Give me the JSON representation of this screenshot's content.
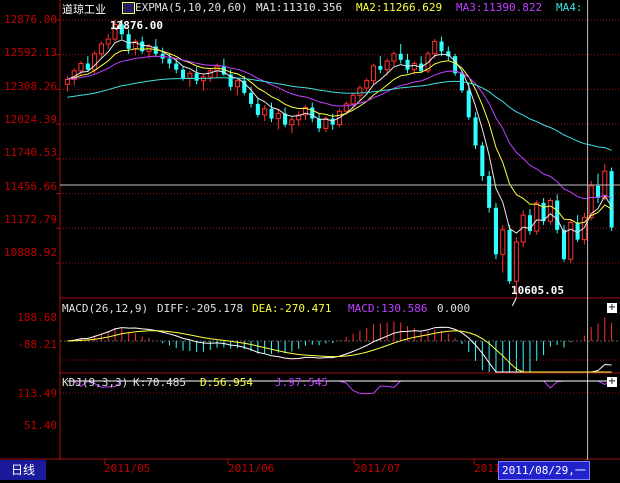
{
  "main": {
    "name": "道琼工业",
    "indicator": "EXPMA(5,10,20,60)",
    "ma": [
      {
        "label": "MA1:11310.356",
        "color": "#e8e8e8"
      },
      {
        "label": "MA2:11266.629",
        "color": "#ffff40"
      },
      {
        "label": "MA3:11390.822",
        "color": "#c040ff"
      },
      {
        "label": "MA4:",
        "color": "#40e0e0"
      }
    ],
    "y_ticks": [
      "12876.00",
      "12592.13",
      "12308.26",
      "12024.39",
      "11740.53",
      "11456.66",
      "11172.79",
      "10888.92"
    ],
    "y_values": [
      12876.0,
      12592.13,
      12308.26,
      12024.39,
      11740.53,
      11456.66,
      11172.79,
      10888.92
    ],
    "high_label": "12876.00",
    "low_label": "10605.05"
  },
  "macd": {
    "header": "MACD(26,12,9)",
    "diff": "DIFF:-205.178",
    "dea": "DEA:-270.471",
    "macd": "MACD:130.586",
    "zero": "0.000",
    "y_ticks": [
      "188.68",
      "-88.21"
    ]
  },
  "kdj": {
    "header": "KDJ(9,3,3)",
    "k": "K:70.485",
    "d": "D:56.954",
    "j": "J:97.545",
    "y_ticks": [
      "113.49",
      "51.40"
    ]
  },
  "x_axis": {
    "labels": [
      "2011/05",
      "2011/06",
      "2011/07",
      "2011/"
    ],
    "cursor_date": "2011/08/29,一",
    "period": "日线"
  },
  "colors": {
    "up": "#ff3030",
    "down": "#30ffff",
    "grid_red": "#a01010",
    "axis_text": "#c00000",
    "k_line": "#ffffff",
    "d_line": "#ffff40",
    "j_line": "#c040ff"
  },
  "chart_data": {
    "type": "candlestick",
    "series": [
      {
        "name": "OHLC",
        "values": [
          [
            12350,
            12420,
            12290,
            12390
          ],
          [
            12390,
            12480,
            12340,
            12460
          ],
          [
            12460,
            12540,
            12420,
            12520
          ],
          [
            12520,
            12580,
            12450,
            12470
          ],
          [
            12470,
            12620,
            12440,
            12600
          ],
          [
            12600,
            12700,
            12560,
            12680
          ],
          [
            12680,
            12760,
            12640,
            12720
          ],
          [
            12720,
            12880,
            12700,
            12840
          ],
          [
            12840,
            12876,
            12720,
            12760
          ],
          [
            12760,
            12800,
            12600,
            12640
          ],
          [
            12640,
            12720,
            12590,
            12700
          ],
          [
            12700,
            12740,
            12600,
            12620
          ],
          [
            12620,
            12680,
            12560,
            12660
          ],
          [
            12660,
            12720,
            12580,
            12600
          ],
          [
            12600,
            12650,
            12520,
            12560
          ],
          [
            12560,
            12600,
            12480,
            12520
          ],
          [
            12520,
            12560,
            12440,
            12470
          ],
          [
            12470,
            12500,
            12380,
            12400
          ],
          [
            12400,
            12460,
            12330,
            12440
          ],
          [
            12440,
            12490,
            12350,
            12380
          ],
          [
            12380,
            12430,
            12300,
            12410
          ],
          [
            12410,
            12480,
            12370,
            12460
          ],
          [
            12460,
            12520,
            12400,
            12500
          ],
          [
            12500,
            12560,
            12420,
            12430
          ],
          [
            12430,
            12470,
            12300,
            12330
          ],
          [
            12330,
            12400,
            12260,
            12380
          ],
          [
            12380,
            12420,
            12260,
            12280
          ],
          [
            12280,
            12330,
            12160,
            12190
          ],
          [
            12190,
            12240,
            12080,
            12100
          ],
          [
            12100,
            12180,
            12050,
            12150
          ],
          [
            12150,
            12200,
            12040,
            12070
          ],
          [
            12070,
            12140,
            11980,
            12110
          ],
          [
            12110,
            12160,
            12000,
            12020
          ],
          [
            12020,
            12090,
            11950,
            12060
          ],
          [
            12060,
            12130,
            12010,
            12100
          ],
          [
            12100,
            12180,
            12060,
            12160
          ],
          [
            12160,
            12200,
            12040,
            12070
          ],
          [
            12070,
            12110,
            11960,
            11990
          ],
          [
            11990,
            12090,
            11960,
            12070
          ],
          [
            12070,
            12110,
            11980,
            12020
          ],
          [
            12020,
            12150,
            12000,
            12130
          ],
          [
            12130,
            12210,
            12100,
            12190
          ],
          [
            12190,
            12280,
            12150,
            12260
          ],
          [
            12260,
            12340,
            12220,
            12320
          ],
          [
            12320,
            12400,
            12270,
            12380
          ],
          [
            12380,
            12520,
            12350,
            12500
          ],
          [
            12500,
            12580,
            12440,
            12470
          ],
          [
            12470,
            12560,
            12420,
            12540
          ],
          [
            12540,
            12620,
            12500,
            12600
          ],
          [
            12600,
            12680,
            12520,
            12550
          ],
          [
            12550,
            12600,
            12440,
            12470
          ],
          [
            12470,
            12540,
            12430,
            12520
          ],
          [
            12520,
            12580,
            12440,
            12460
          ],
          [
            12460,
            12620,
            12440,
            12600
          ],
          [
            12600,
            12720,
            12560,
            12700
          ],
          [
            12700,
            12740,
            12580,
            12620
          ],
          [
            12620,
            12660,
            12540,
            12580
          ],
          [
            12580,
            12600,
            12420,
            12440
          ],
          [
            12440,
            12460,
            12280,
            12300
          ],
          [
            12300,
            12360,
            12060,
            12080
          ],
          [
            12080,
            12120,
            11820,
            11850
          ],
          [
            11850,
            11880,
            11560,
            11600
          ],
          [
            11600,
            11640,
            11300,
            11340
          ],
          [
            11340,
            11380,
            10920,
            10960
          ],
          [
            10960,
            11200,
            10810,
            11160
          ],
          [
            11160,
            11200,
            10720,
            10740
          ],
          [
            10740,
            11100,
            10605,
            11060
          ],
          [
            11060,
            11320,
            11020,
            11280
          ],
          [
            11280,
            11330,
            11120,
            11150
          ],
          [
            11150,
            11400,
            11120,
            11380
          ],
          [
            11380,
            11420,
            11200,
            11230
          ],
          [
            11230,
            11420,
            11200,
            11400
          ],
          [
            11400,
            11450,
            11130,
            11160
          ],
          [
            11160,
            11200,
            10900,
            10920
          ],
          [
            10920,
            11250,
            10890,
            11220
          ],
          [
            11220,
            11280,
            11060,
            11080
          ],
          [
            11080,
            11300,
            11040,
            11260
          ],
          [
            11260,
            11560,
            11240,
            11520
          ],
          [
            11520,
            11620,
            11380,
            11420
          ],
          [
            11420,
            11700,
            11400,
            11640
          ],
          [
            11640,
            11670,
            11150,
            11180
          ]
        ]
      }
    ]
  }
}
